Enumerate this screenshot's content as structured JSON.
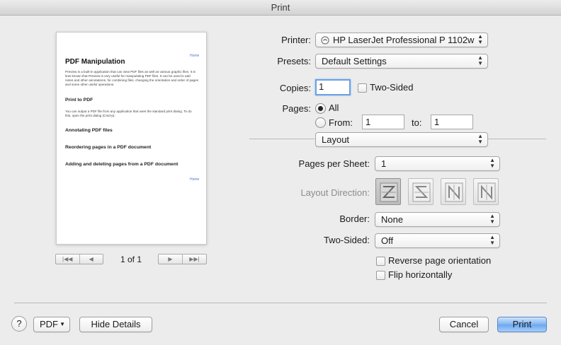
{
  "window": {
    "title": "Print"
  },
  "preview": {
    "home_link_top": "Home",
    "doc_title": "PDF Manipulation",
    "intro_text": "Preview is a built-in application that can view PDF files as well as various graphic files. It is less known that Preview is very useful for manipulating PDF files. It can be used to add notes and other annotations, for combining files, changing the orientation and order of pages and some other useful operations.",
    "section1_title": "Print to PDF",
    "section1_text": "You can output a PDF file from any application that uses the standard print dialog. To do this, open the print dialog (Cmd-p).",
    "section2_title": "Annotating PDF files",
    "section3_title": "Reordering pages in a PDF document",
    "section4_title": "Adding and deleting pages from a PDF document",
    "home_link_bottom": "Home",
    "page_count": "1 of 1"
  },
  "printer": {
    "label": "Printer:",
    "value": "HP LaserJet Professional P 1102w"
  },
  "presets": {
    "label": "Presets:",
    "value": "Default Settings"
  },
  "copies": {
    "label": "Copies:",
    "value": "1",
    "two_sided_label": "Two-Sided"
  },
  "pages": {
    "label": "Pages:",
    "all_label": "All",
    "from_label": "From:",
    "from_value": "1",
    "to_label": "to:",
    "to_value": "1"
  },
  "section_popup": {
    "value": "Layout"
  },
  "layout": {
    "pages_per_sheet_label": "Pages per Sheet:",
    "pages_per_sheet_value": "1",
    "direction_label": "Layout Direction:",
    "direction_icons": [
      "z-direction-icon",
      "s-direction-icon",
      "n-reverse-direction-icon",
      "n-direction-icon"
    ],
    "border_label": "Border:",
    "border_value": "None",
    "two_sided_label": "Two-Sided:",
    "two_sided_value": "Off",
    "reverse_label": "Reverse page orientation",
    "flip_label": "Flip horizontally"
  },
  "footer": {
    "help_label": "?",
    "pdf_label": "PDF",
    "hide_details_label": "Hide Details",
    "cancel_label": "Cancel",
    "print_label": "Print"
  },
  "colors": {
    "accent": "#6aa7f0",
    "focus": "#6aa0e6",
    "link": "#4a7bc8"
  }
}
